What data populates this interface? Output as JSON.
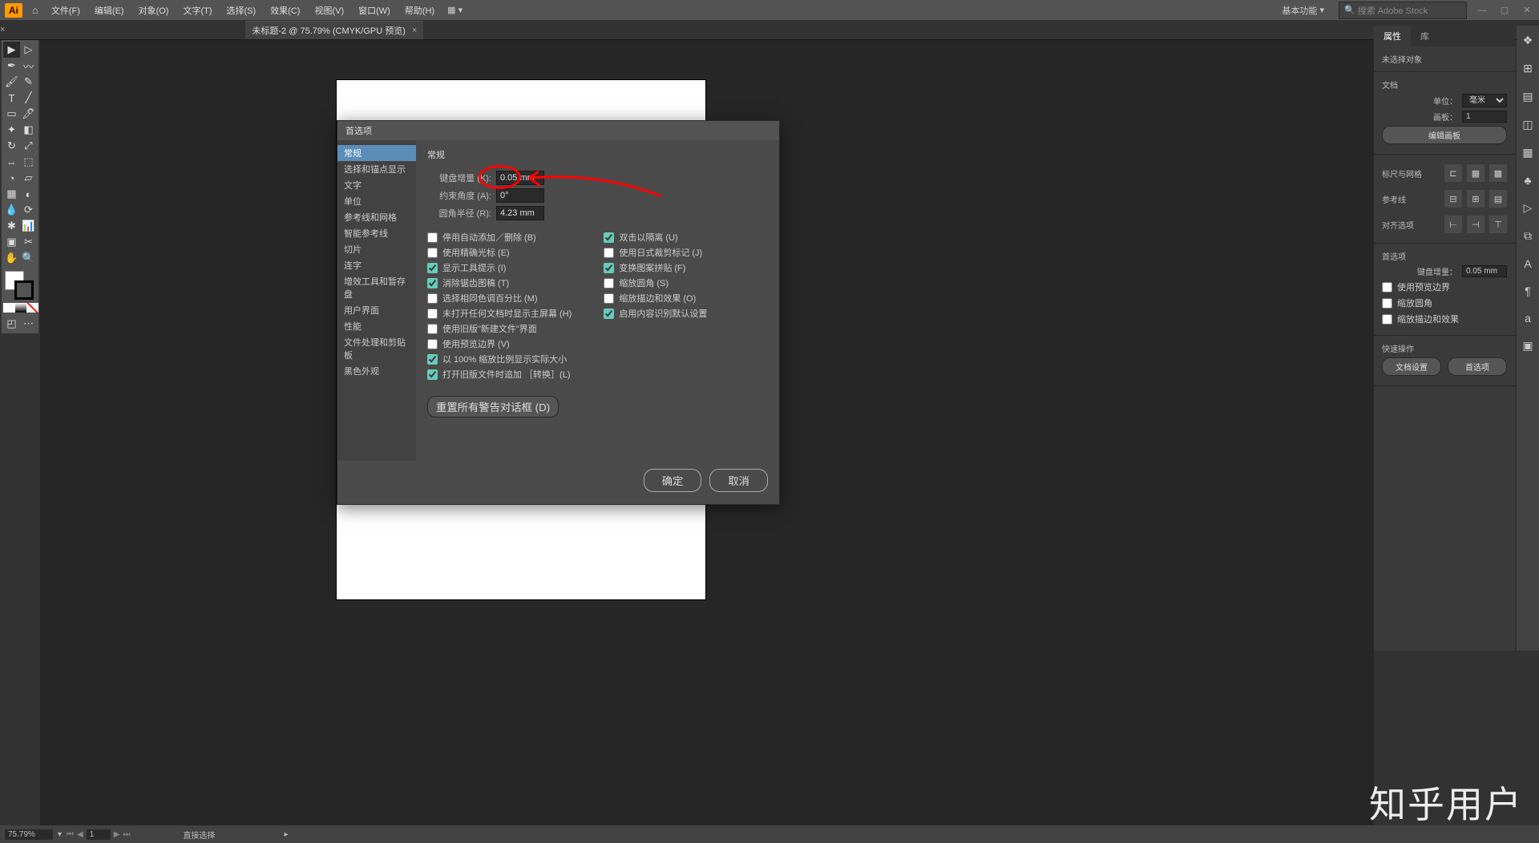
{
  "app": {
    "logo": "Ai"
  },
  "menu": {
    "items": [
      "文件(F)",
      "编辑(E)",
      "对象(O)",
      "文字(T)",
      "选择(S)",
      "效果(C)",
      "视图(V)",
      "窗口(W)",
      "帮助(H)"
    ],
    "workspace": "基本功能",
    "search_placeholder": "搜索 Adobe Stock"
  },
  "tab": {
    "title": "未标题-2 @ 75.79% (CMYK/GPU 预览)"
  },
  "dialog": {
    "title": "首选项",
    "cats": [
      "常规",
      "选择和锚点显示",
      "文字",
      "单位",
      "参考线和网格",
      "智能参考线",
      "切片",
      "连字",
      "增效工具和暂存盘",
      "用户界面",
      "性能",
      "文件处理和剪贴板",
      "黑色外观"
    ],
    "active_cat": "常规",
    "heading": "常规",
    "fields": {
      "key_inc_label": "键盘增量 (K):",
      "key_inc": "0.05 mm",
      "angle_label": "约束角度 (A):",
      "angle": "0°",
      "radius_label": "圆角半径 (R):",
      "radius": "4.23 mm"
    },
    "left_checks": [
      {
        "l": "停用自动添加／删除 (B)",
        "c": false
      },
      {
        "l": "使用精确光标 (E)",
        "c": false
      },
      {
        "l": "显示工具提示 (I)",
        "c": true
      },
      {
        "l": "消除锯齿图稿 (T)",
        "c": true
      },
      {
        "l": "选择相同色调百分比 (M)",
        "c": false
      },
      {
        "l": "未打开任何文档时显示主屏幕 (H)",
        "c": false
      },
      {
        "l": "使用旧版\"新建文件\"界面",
        "c": false
      },
      {
        "l": "使用预览边界 (V)",
        "c": false
      },
      {
        "l": "以 100% 缩放比例显示实际大小",
        "c": true
      },
      {
        "l": "打开旧版文件时追加 ［转换］(L)",
        "c": true
      }
    ],
    "right_checks": [
      {
        "l": "双击以隔离 (U)",
        "c": true
      },
      {
        "l": "使用日式裁剪标记 (J)",
        "c": false
      },
      {
        "l": "变换图案拼贴 (F)",
        "c": true
      },
      {
        "l": "缩放圆角 (S)",
        "c": false
      },
      {
        "l": "缩放描边和效果 (O)",
        "c": false
      },
      {
        "l": "启用内容识别默认设置",
        "c": true
      }
    ],
    "reset_button": "重置所有警告对话框 (D)",
    "ok": "确定",
    "cancel": "取消"
  },
  "props": {
    "tabs": [
      "属性",
      "库"
    ],
    "no_sel": "未选择对象",
    "doc_label": "文档",
    "unit_label": "单位：",
    "unit_value": "毫米",
    "artboard_label": "画板：",
    "artboard_value": "1",
    "edit_artboard": "编辑画板",
    "rulers_label": "标尺与网格",
    "guides_label": "参考线",
    "snap_label": "对齐选项",
    "prefs_label": "首选项",
    "key_label": "键盘增量：",
    "key_value": "0.05 mm",
    "cb1": "使用预览边界",
    "cb2": "缩放圆角",
    "cb3": "缩放描边和效果",
    "quick_label": "快速操作",
    "doc_setup": "文档设置",
    "prefs_btn": "首选项"
  },
  "status": {
    "zoom": "75.79%",
    "artboard": "1",
    "tool": "直接选择"
  },
  "watermark": "知乎用户"
}
